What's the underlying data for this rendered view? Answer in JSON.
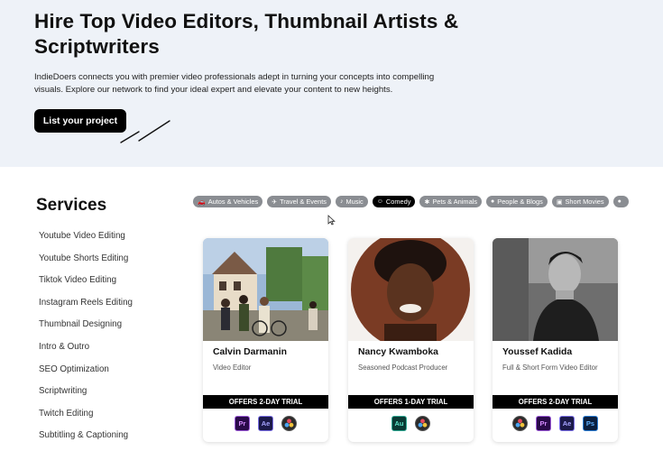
{
  "hero": {
    "title": "Hire Top Video Editors, Thumbnail Artists & Scriptwriters",
    "description": "IndieDoers connects you with premier video professionals adept in turning your concepts into compelling visuals. Explore our network to find your ideal expert and elevate your content to new heights.",
    "cta_label": "List your project"
  },
  "services": {
    "title": "Services",
    "items": [
      "Youtube Video Editing",
      "Youtube Shorts Editing",
      "Tiktok Video Editing",
      "Instagram Reels Editing",
      "Thumbnail Designing",
      "Intro & Outro",
      "SEO Optimization",
      "Scriptwriting",
      "Twitch Editing",
      "Subtitling & Captioning"
    ]
  },
  "categories": [
    {
      "label": "Autos & Vehicles",
      "icon": "car-icon",
      "glyph": "🚗",
      "active": false
    },
    {
      "label": "Travel & Events",
      "icon": "plane-icon",
      "glyph": "✈",
      "active": false
    },
    {
      "label": "Music",
      "icon": "music-icon",
      "glyph": "♪",
      "active": false
    },
    {
      "label": "Comedy",
      "icon": "smile-icon",
      "glyph": "☺",
      "active": true
    },
    {
      "label": "Pets & Animals",
      "icon": "paw-icon",
      "glyph": "✱",
      "active": false
    },
    {
      "label": "People & Blogs",
      "icon": "people-icon",
      "glyph": "●",
      "active": false
    },
    {
      "label": "Short Movies",
      "icon": "film-icon",
      "glyph": "▣",
      "active": false
    },
    {
      "label": "",
      "icon": "more-icon",
      "glyph": "●",
      "active": false
    }
  ],
  "cards": [
    {
      "name": "Calvin Darmanin",
      "role": "Video Editor",
      "trial": "OFFERS 2-DAY TRIAL",
      "tools": [
        {
          "icon": "premiere-pro-icon",
          "abbr": "Pr",
          "cls": "pr"
        },
        {
          "icon": "after-effects-icon",
          "abbr": "Ae",
          "cls": "ae"
        },
        {
          "icon": "davinci-resolve-icon",
          "abbr": "",
          "cls": "dv"
        }
      ]
    },
    {
      "name": "Nancy Kwamboka",
      "role": "Seasoned Podcast Producer",
      "trial": "OFFERS 1-DAY TRIAL",
      "tools": [
        {
          "icon": "audition-icon",
          "abbr": "Au",
          "cls": "au"
        },
        {
          "icon": "davinci-resolve-icon",
          "abbr": "",
          "cls": "dv"
        }
      ]
    },
    {
      "name": "Youssef Kadida",
      "role": "Full & Short Form Video Editor",
      "trial": "OFFERS 2-DAY TRIAL",
      "tools": [
        {
          "icon": "davinci-resolve-icon",
          "abbr": "",
          "cls": "dv"
        },
        {
          "icon": "premiere-pro-icon",
          "abbr": "Pr",
          "cls": "pr"
        },
        {
          "icon": "after-effects-icon",
          "abbr": "Ae",
          "cls": "ae"
        },
        {
          "icon": "photoshop-icon",
          "abbr": "Ps",
          "cls": "ps"
        }
      ]
    }
  ]
}
